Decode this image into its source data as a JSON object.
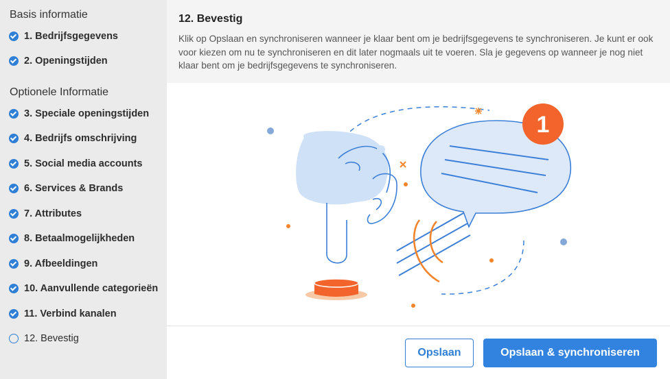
{
  "sidebar": {
    "basic_title": "Basis informatie",
    "optional_title": "Optionele Informatie",
    "steps": [
      {
        "label": "1. Bedrijfsgegevens",
        "status": "done"
      },
      {
        "label": "2. Openingstijden",
        "status": "done"
      },
      {
        "label": "3. Speciale openingstijden",
        "status": "done"
      },
      {
        "label": "4. Bedrijfs omschrijving",
        "status": "done"
      },
      {
        "label": "5. Social media accounts",
        "status": "done"
      },
      {
        "label": "6. Services & Brands",
        "status": "done"
      },
      {
        "label": "7. Attributes",
        "status": "done"
      },
      {
        "label": "8. Betaalmogelijkheden",
        "status": "done"
      },
      {
        "label": "9. Afbeeldingen",
        "status": "done"
      },
      {
        "label": "10. Aanvullende categorieën",
        "status": "done"
      },
      {
        "label": "11. Verbind kanalen",
        "status": "done"
      },
      {
        "label": "12. Bevestig",
        "status": "current"
      }
    ]
  },
  "main": {
    "title": "12. Bevestig",
    "description": "Klik op Opslaan en synchroniseren wanneer je klaar bent om je bedrijfsgegevens te synchroniseren. Je kunt er ook voor kiezen om nu te synchroniseren en dit later nogmaals uit te voeren. Sla je gegevens op wanneer je nog niet klaar bent om je bedrijfsgegevens te synchroniseren.",
    "notification_count": "1"
  },
  "footer": {
    "save_label": "Opslaan",
    "save_sync_label": "Opslaan & synchroniseren"
  },
  "colors": {
    "accent": "#3283df",
    "check": "#2f7fd6",
    "badge": "#f2642c",
    "illustration_blue": "#3b7fd8",
    "illustration_light": "#cfe1f7"
  }
}
